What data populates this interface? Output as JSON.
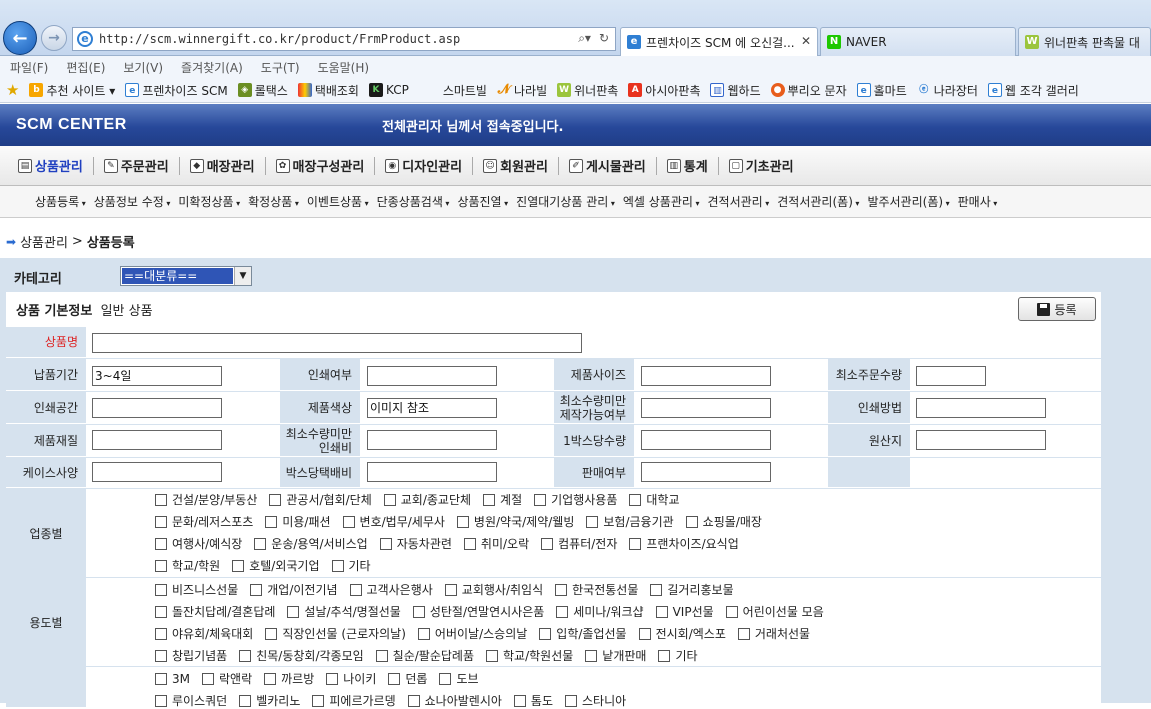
{
  "browser": {
    "url": "http://scm.winnergift.co.kr/product/FrmProduct.asp",
    "tabs": [
      {
        "label": "프렌차이즈 SCM 에 오신걸...",
        "active": true
      },
      {
        "label": "NAVER",
        "active": false
      },
      {
        "label": "위너판촉 판촉물 대",
        "active": false
      }
    ],
    "menu": [
      "파일(F)",
      "편집(E)",
      "보기(V)",
      "즐겨찾기(A)",
      "도구(T)",
      "도움말(H)"
    ],
    "favorites": [
      "추천 사이트 ▾",
      "프렌차이즈 SCM",
      "롤택스",
      "택배조회",
      "KCP",
      "스마트빌",
      "나라빌",
      "위너판촉",
      "아시아판촉",
      "웹하드",
      "뿌리오 문자",
      "홀마트",
      "나라장터",
      "웹 조각 갤러리"
    ]
  },
  "header": {
    "logo": "SCM CENTER",
    "welcome": "전체관리자 님께서 접속중입니다."
  },
  "main_nav": [
    "상품관리",
    "주문관리",
    "매장관리",
    "매장구성관리",
    "디자인관리",
    "회원관리",
    "게시물관리",
    "통계",
    "기초관리"
  ],
  "sub_nav": [
    "상품등록",
    "상품정보 수정",
    "미확정상품",
    "확정상품",
    "이벤트상품",
    "단종상품검색",
    "상품진열",
    "진열대기상품 관리",
    "엑셀 상품관리",
    "견적서관리",
    "견적서관리(폼)",
    "발주서관리(폼)",
    "판매사"
  ],
  "breadcrumb": {
    "parent": "상품관리",
    "sep": ">",
    "current": "상품등록"
  },
  "category": {
    "label": "카테고리",
    "selected": "==대분류=="
  },
  "basic": {
    "title": "상품 기본정보",
    "subtitle": "일반 상품",
    "register": "등록"
  },
  "form": {
    "name_label": "상품명",
    "rows": [
      {
        "l1": "납품기간",
        "v1": "3~4일",
        "l2": "인쇄여부",
        "v2": "",
        "l3": "제품사이즈",
        "v3": "",
        "l4": "최소주문수량",
        "v4": ""
      },
      {
        "l1": "인쇄공간",
        "v1": "",
        "l2": "제품색상",
        "v2": "이미지 참조",
        "l3": "최소수량미만 제작가능여부",
        "v3": "",
        "l4": "인쇄방법",
        "v4": ""
      },
      {
        "l1": "제품재질",
        "v1": "",
        "l2": "최소수량미만 인쇄비",
        "v2": "",
        "l3": "1박스당수량",
        "v3": "",
        "l4": "원산지",
        "v4": ""
      },
      {
        "l1": "케이스사양",
        "v1": "",
        "l2": "박스당택배비",
        "v2": "",
        "l3": "판매여부",
        "v3": ""
      }
    ]
  },
  "industry": {
    "label": "업종별",
    "lines": [
      [
        "건설/분양/부동산",
        "관공서/협회/단체",
        "교회/종교단체",
        "계절",
        "기업행사용품",
        "대학교"
      ],
      [
        "문화/레저스포츠",
        "미용/패션",
        "변호/법무/세무사",
        "병원/약국/제약/웰빙",
        "보험/금융기관",
        "쇼핑몰/매장"
      ],
      [
        "여행사/예식장",
        "운송/용역/서비스업",
        "자동차관련",
        "취미/오락",
        "컴퓨터/전자",
        "프랜차이즈/요식업"
      ],
      [
        "학교/학원",
        "호텔/외국기업",
        "기타"
      ]
    ]
  },
  "usage": {
    "label": "용도별",
    "lines": [
      [
        "비즈니스선물",
        "개업/이전기념",
        "고객사은행사",
        "교회행사/취임식",
        "한국전통선물",
        "길거리홍보물"
      ],
      [
        "돌잔치답례/결혼답례",
        "설날/추석/명절선물",
        "성탄절/연말연시사은품",
        "세미나/워크샵",
        "VIP선물",
        "어린이선물 모음"
      ],
      [
        "야유회/체육대회",
        "직장인선물 (근로자의날)",
        "어버이날/스승의날",
        "입학/졸업선물",
        "전시회/엑스포",
        "거래처선물"
      ],
      [
        "창립기념품",
        "친목/동창회/각종모임",
        "칠순/팔순답례품",
        "학교/학원선물",
        "낱개판매",
        "기타"
      ]
    ]
  },
  "brand": {
    "lines": [
      [
        "3M",
        "락앤락",
        "까르방",
        "나이키",
        "던롭",
        "도브"
      ],
      [
        "루이스쿼던",
        "벨카리노",
        "피에르가르뎅",
        "쇼나아발렌시아",
        "톰도",
        "스타니아"
      ]
    ]
  }
}
